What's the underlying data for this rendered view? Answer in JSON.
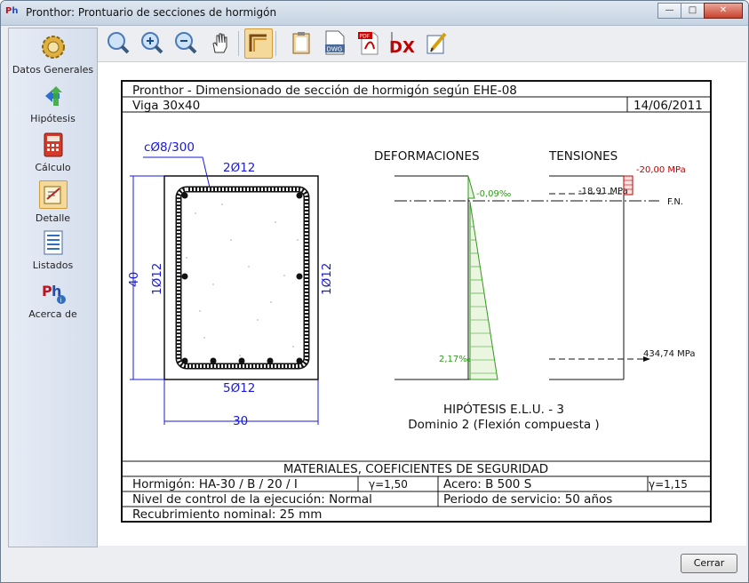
{
  "window": {
    "title": "Pronthor: Prontuario de secciones de hormigón",
    "app_icon": "Ph",
    "close_label": "Cerrar"
  },
  "sidebar": {
    "items": [
      {
        "label": "Datos Generales",
        "icon": "gear-icon"
      },
      {
        "label": "Hipótesis",
        "icon": "arrows-icon"
      },
      {
        "label": "Cálculo",
        "icon": "calculator-icon"
      },
      {
        "label": "Detalle",
        "icon": "detail-icon",
        "selected": true
      },
      {
        "label": "Listados",
        "icon": "list-icon"
      },
      {
        "label": "Acerca de",
        "icon": "about-icon"
      }
    ]
  },
  "toolbar": {
    "items": [
      "zoom-icon",
      "zoom-in-icon",
      "zoom-out-icon",
      "pan-hand-icon",
      "frame-icon",
      "clipboard-icon",
      "dwg-icon",
      "pdf-icon",
      "dxf-icon",
      "edit-icon"
    ]
  },
  "drawing": {
    "header_title": "Pronthor - Dimensionado de sección de hormigón según EHE-08",
    "section_name": "Viga 30x40",
    "date": "14/06/2011",
    "stirrup_label": "cØ8/300",
    "top_bars": "2Ø12",
    "bottom_bars": "5Ø12",
    "left_bars": "1Ø12",
    "right_bars": "1Ø12",
    "height_dim": "40",
    "width_dim": "30",
    "deformations_title": "DEFORMACIONES",
    "tensions_title": "TENSIONES",
    "strain_top": "-0,09‰",
    "strain_bottom": "2,17‰",
    "stress_top_concrete": "-20,00 MPa",
    "stress_top_steel": "-18,91 MPa",
    "stress_bottom_steel": "434,74 MPa",
    "neutral_axis": "F.N.",
    "hypothesis": "HIPÓTESIS E.L.U. - 3",
    "domain": "Dominio 2 (Flexión compuesta )",
    "materials_title": "MATERIALES, COEFICIENTES DE SEGURIDAD",
    "concrete": "Hormigón: HA-30 / B / 20 / I",
    "gamma_c": "γ=1,50",
    "steel": "Acero: B 500 S",
    "gamma_s": "γ=1,15",
    "control": "Nivel de control de la ejecución: Normal",
    "service": "Periodo de servicio: 50 años",
    "cover": "Recubrimiento nominal: 25 mm"
  },
  "colors": {
    "dimension": "#1a1ad8",
    "strain": "#2f9a1a",
    "stress": "#c00000"
  }
}
